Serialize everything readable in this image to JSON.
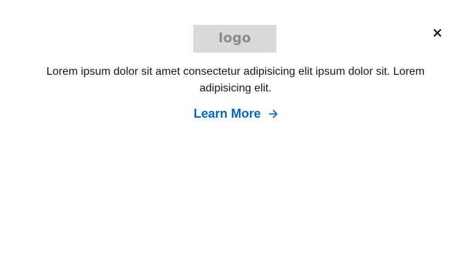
{
  "modal": {
    "logo_text": "logo",
    "body_text": "Lorem ipsum dolor sit amet consectetur adipisicing elit ipsum dolor sit. Lorem adipisicing elit.",
    "link_label": "Learn More",
    "close_icon": "close-icon",
    "arrow_icon": "arrow-right-icon"
  },
  "colors": {
    "background": "#ffffff",
    "text": "#151515",
    "link": "#0066cc",
    "logo_placeholder_bg": "#d9d9d9",
    "logo_placeholder_text": "#8a8a8a",
    "close_icon": "#151515"
  }
}
